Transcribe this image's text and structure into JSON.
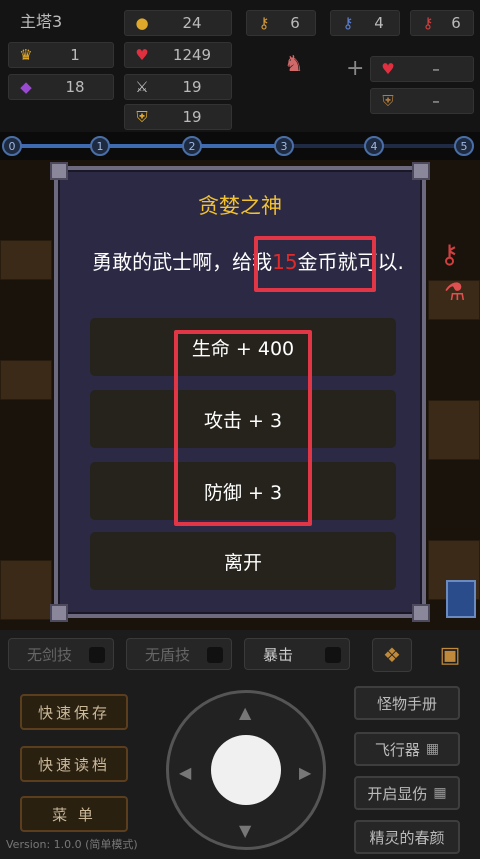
{
  "top": {
    "floor": "主塔3",
    "gold": "24",
    "yellow_keys": "6",
    "blue_keys": "4",
    "red_keys": "6",
    "level": "1",
    "exp": "18",
    "hp": "1249",
    "attack": "19",
    "defense": "19",
    "bonus_hp": "–",
    "bonus_def": "–",
    "plus": "+"
  },
  "track": {
    "nodes": [
      "0",
      "1",
      "2",
      "3",
      "4",
      "5"
    ]
  },
  "dialog": {
    "title": "贪婪之神",
    "text_before": "勇敢的武士啊，给我",
    "amount": "15",
    "text_after": "金币就可以.",
    "options": [
      "生命 + 400",
      "攻击 + 3",
      "防御 + 3",
      "离开"
    ]
  },
  "skills": [
    "无剑技",
    "无盾技",
    "暴击"
  ],
  "left_buttons": [
    "快速保存",
    "快速读档",
    "菜 单"
  ],
  "right_buttons": [
    "怪物手册",
    "飞行器",
    "开启显伤",
    "精灵的春颜"
  ],
  "version": "Version: 1.0.0 (简单模式)",
  "colors": {
    "title": "#f2c12e",
    "highlight": "#e03646",
    "amount": "#e02a2a"
  }
}
